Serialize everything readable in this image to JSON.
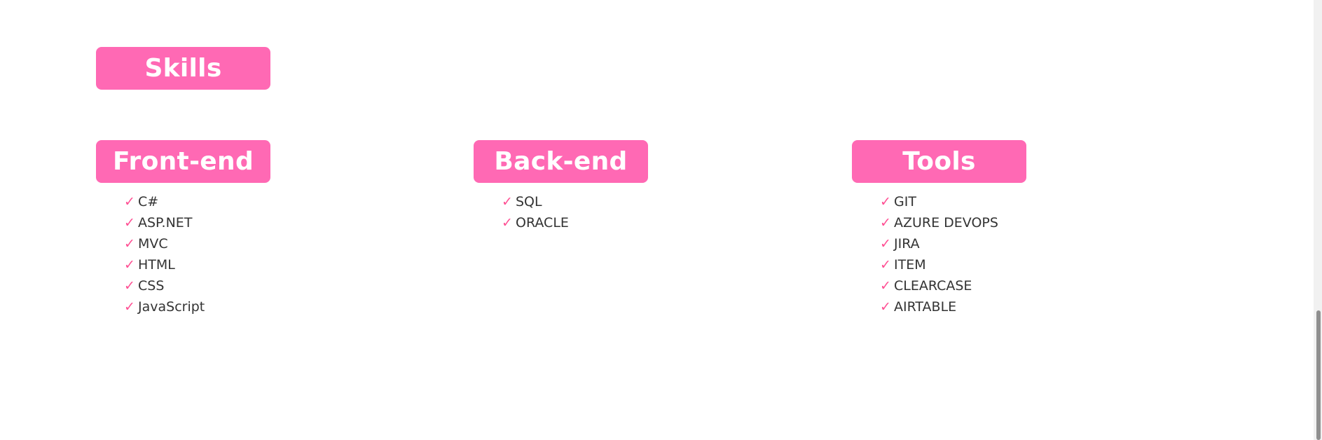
{
  "section": {
    "title": "Skills"
  },
  "colors": {
    "accent": "#ff69b4",
    "check": "#ff4f93",
    "text": "#333333"
  },
  "categories": [
    {
      "title": "Front-end",
      "items": [
        "C#",
        "ASP.NET",
        "MVC",
        "HTML",
        "CSS",
        "JavaScript"
      ]
    },
    {
      "title": "Back-end",
      "items": [
        "SQL",
        "ORACLE"
      ]
    },
    {
      "title": "Tools",
      "items": [
        "GIT",
        "AZURE DEVOPS",
        "JIRA",
        "ITEM",
        "CLEARCASE",
        "AIRTABLE"
      ]
    }
  ],
  "check_icon": {
    "glyph": "✓",
    "name": "check-icon"
  }
}
